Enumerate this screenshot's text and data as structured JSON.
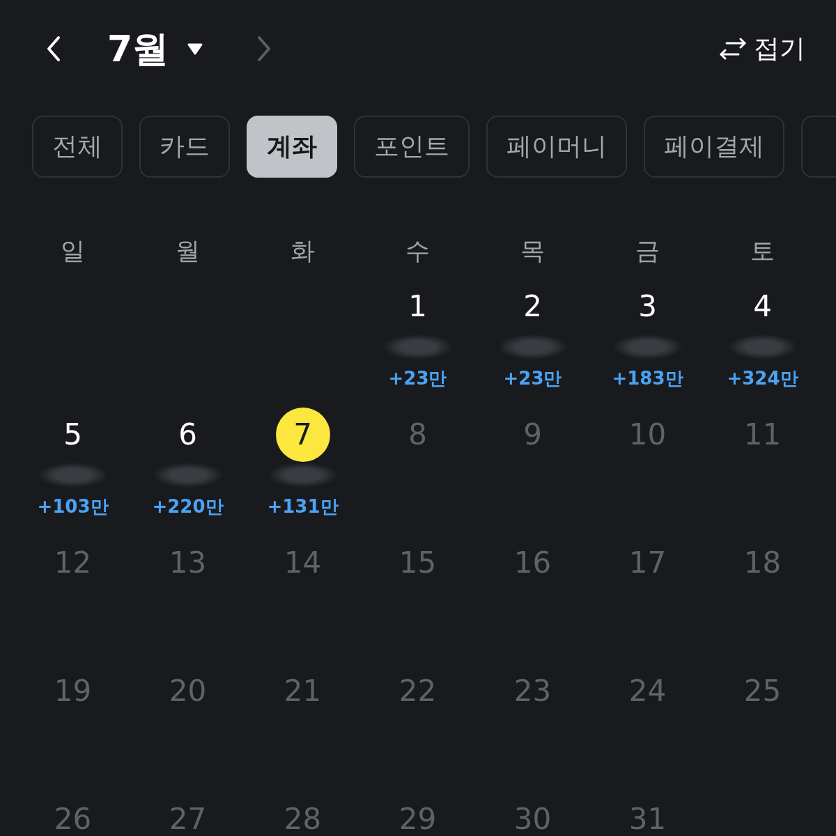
{
  "header": {
    "prev": {
      "disabled": false
    },
    "month": "7월",
    "next": {
      "disabled": true
    },
    "collapse": {
      "label": "접기"
    }
  },
  "tabs": [
    {
      "label": "전체",
      "selected": false
    },
    {
      "label": "카드",
      "selected": false
    },
    {
      "label": "계좌",
      "selected": true
    },
    {
      "label": "포인트",
      "selected": false
    },
    {
      "label": "페이머니",
      "selected": false
    },
    {
      "label": "페이결제",
      "selected": false
    },
    {
      "selected": false
    }
  ],
  "weekdays": [
    "일",
    "월",
    "화",
    "수",
    "목",
    "금",
    "토"
  ],
  "weeks": [
    [
      {
        "kind": "blank"
      },
      {
        "kind": "blank"
      },
      {
        "kind": "blank"
      },
      {
        "kind": "day",
        "day": "1",
        "selected": false,
        "disabled": false,
        "hidden_amount": true,
        "amount": "+23만"
      },
      {
        "kind": "day",
        "day": "2",
        "selected": false,
        "disabled": false,
        "hidden_amount": true,
        "amount": "+23만"
      },
      {
        "kind": "day",
        "day": "3",
        "selected": false,
        "disabled": false,
        "hidden_amount": true,
        "amount": "+183만"
      },
      {
        "kind": "day",
        "day": "4",
        "selected": false,
        "disabled": false,
        "hidden_amount": true,
        "amount": "+324만"
      }
    ],
    [
      {
        "kind": "day",
        "day": "5",
        "selected": false,
        "disabled": false,
        "hidden_amount": true,
        "amount": "+103만"
      },
      {
        "kind": "day",
        "day": "6",
        "selected": false,
        "disabled": false,
        "hidden_amount": true,
        "amount": "+220만"
      },
      {
        "kind": "day",
        "day": "7",
        "selected": true,
        "disabled": false,
        "hidden_amount": true,
        "amount": "+131만"
      },
      {
        "kind": "day",
        "day": "8",
        "selected": false,
        "disabled": true,
        "hidden_amount": false
      },
      {
        "kind": "day",
        "day": "9",
        "selected": false,
        "disabled": true,
        "hidden_amount": false
      },
      {
        "kind": "day",
        "day": "10",
        "selected": false,
        "disabled": true,
        "hidden_amount": false
      },
      {
        "kind": "day",
        "day": "11",
        "selected": false,
        "disabled": true,
        "hidden_amount": false
      }
    ],
    [
      {
        "kind": "day",
        "day": "12",
        "selected": false,
        "disabled": true,
        "hidden_amount": false
      },
      {
        "kind": "day",
        "day": "13",
        "selected": false,
        "disabled": true,
        "hidden_amount": false
      },
      {
        "kind": "day",
        "day": "14",
        "selected": false,
        "disabled": true,
        "hidden_amount": false
      },
      {
        "kind": "day",
        "day": "15",
        "selected": false,
        "disabled": true,
        "hidden_amount": false
      },
      {
        "kind": "day",
        "day": "16",
        "selected": false,
        "disabled": true,
        "hidden_amount": false
      },
      {
        "kind": "day",
        "day": "17",
        "selected": false,
        "disabled": true,
        "hidden_amount": false
      },
      {
        "kind": "day",
        "day": "18",
        "selected": false,
        "disabled": true,
        "hidden_amount": false
      }
    ],
    [
      {
        "kind": "day",
        "day": "19",
        "selected": false,
        "disabled": true,
        "hidden_amount": false
      },
      {
        "kind": "day",
        "day": "20",
        "selected": false,
        "disabled": true,
        "hidden_amount": false
      },
      {
        "kind": "day",
        "day": "21",
        "selected": false,
        "disabled": true,
        "hidden_amount": false
      },
      {
        "kind": "day",
        "day": "22",
        "selected": false,
        "disabled": true,
        "hidden_amount": false
      },
      {
        "kind": "day",
        "day": "23",
        "selected": false,
        "disabled": true,
        "hidden_amount": false
      },
      {
        "kind": "day",
        "day": "24",
        "selected": false,
        "disabled": true,
        "hidden_amount": false
      },
      {
        "kind": "day",
        "day": "25",
        "selected": false,
        "disabled": true,
        "hidden_amount": false
      }
    ],
    [
      {
        "kind": "day",
        "day": "26",
        "selected": false,
        "disabled": true,
        "hidden_amount": false
      },
      {
        "kind": "day",
        "day": "27",
        "selected": false,
        "disabled": true,
        "hidden_amount": false
      },
      {
        "kind": "day",
        "day": "28",
        "selected": false,
        "disabled": true,
        "hidden_amount": false
      },
      {
        "kind": "day",
        "day": "29",
        "selected": false,
        "disabled": true,
        "hidden_amount": false
      },
      {
        "kind": "day",
        "day": "30",
        "selected": false,
        "disabled": true,
        "hidden_amount": false
      },
      {
        "kind": "day",
        "day": "31",
        "selected": false,
        "disabled": true,
        "hidden_amount": false
      }
    ]
  ]
}
